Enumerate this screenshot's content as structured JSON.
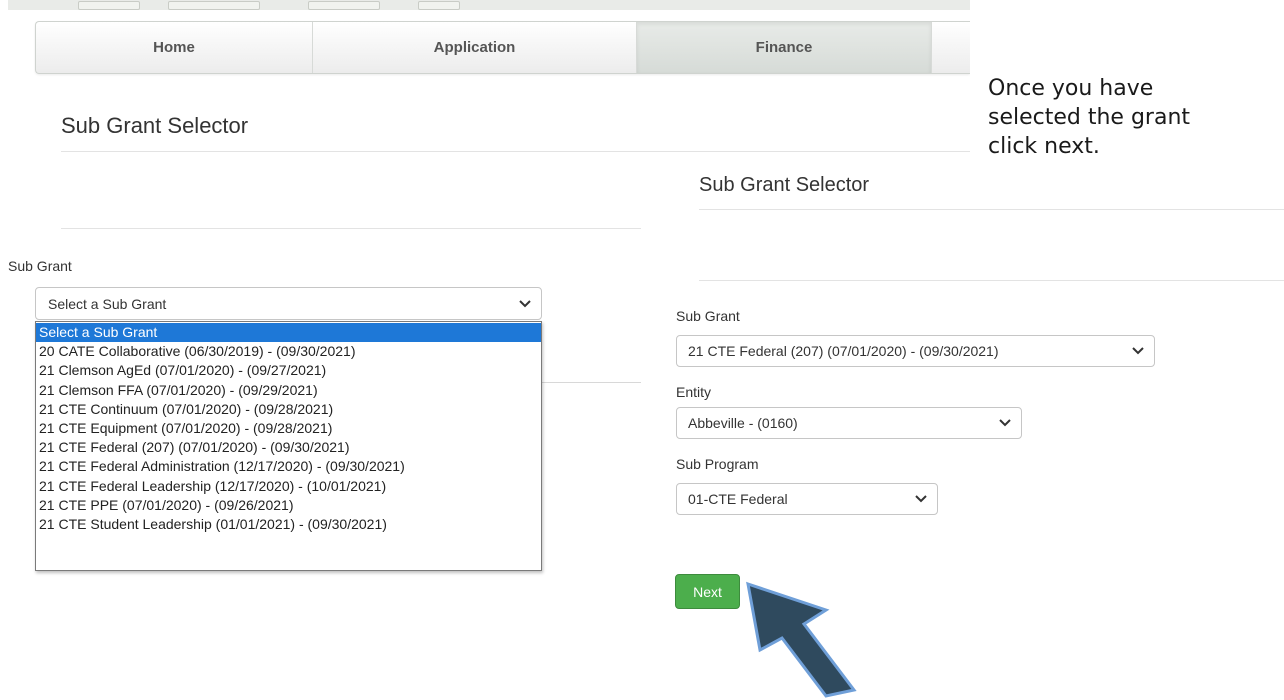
{
  "nav": {
    "home": "Home",
    "application": "Application",
    "finance": "Finance"
  },
  "left_panel": {
    "title": "Sub Grant Selector",
    "sub_grant_label": "Sub Grant",
    "sub_grant_selected": "Select a Sub Grant",
    "options": [
      "Select a Sub Grant",
      "20 CATE Collaborative (06/30/2019) - (09/30/2021)",
      "21 Clemson AgEd (07/01/2020) - (09/27/2021)",
      "21 Clemson FFA (07/01/2020) - (09/29/2021)",
      "21 CTE Continuum (07/01/2020) - (09/28/2021)",
      "21 CTE Equipment (07/01/2020) - (09/28/2021)",
      "21 CTE Federal (207) (07/01/2020) - (09/30/2021)",
      "21 CTE Federal Administration (12/17/2020) - (09/30/2021)",
      "21 CTE Federal Leadership (12/17/2020) - (10/01/2021)",
      "21 CTE PPE (07/01/2020) - (09/26/2021)",
      "21 CTE Student Leadership (01/01/2021) - (09/30/2021)"
    ],
    "highlighted_option_index": 0
  },
  "right_panel": {
    "title": "Sub Grant Selector",
    "sub_grant_label": "Sub Grant",
    "sub_grant_value": "21 CTE Federal (207) (07/01/2020) - (09/30/2021)",
    "entity_label": "Entity",
    "entity_value": "Abbeville - (0160)",
    "sub_program_label": "Sub Program",
    "sub_program_value": "01-CTE Federal",
    "next_label": "Next"
  },
  "annotation": {
    "line1": "Once you have",
    "line2": "selected the grant",
    "line3": "click next."
  },
  "colors": {
    "selected_option": "#1e78d7",
    "next_button": "#4cae4c",
    "arrow_fill": "#2f4a5e",
    "arrow_stroke": "#6f9fd8"
  }
}
